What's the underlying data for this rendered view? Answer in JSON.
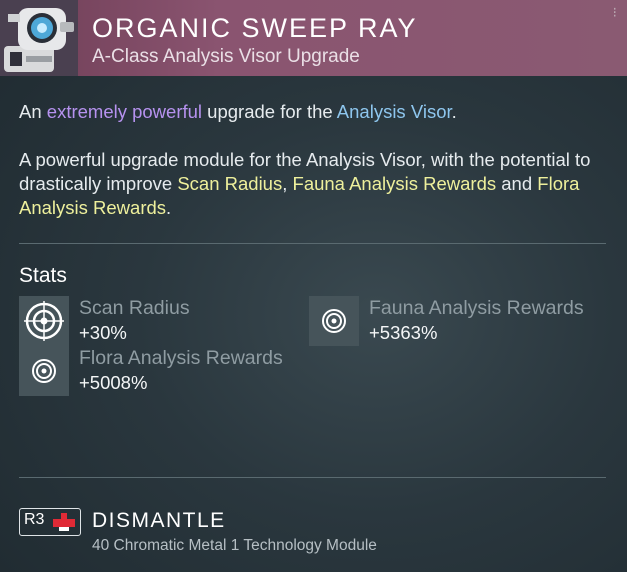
{
  "header": {
    "title": "ORGANIC SWEEP RAY",
    "subtitle": "A-Class Analysis Visor Upgrade",
    "icon": "robot-scanner-icon",
    "close": "⁝",
    "colors": {
      "accent_start": "#6e3d55",
      "accent_end": "#8a5a72"
    }
  },
  "description": {
    "line1_prefix": "An ",
    "line1_highlight": "extremely powerful",
    "line1_middle": " upgrade for the ",
    "line1_link": "Analysis Visor",
    "line1_suffix": ".",
    "para_prefix": "A powerful upgrade module for the Analysis Visor, with the potential to drastically improve ",
    "para_hl1": "Scan Radius",
    "para_sep1": ", ",
    "para_hl2": "Fauna Analysis Rewards",
    "para_sep2": " and ",
    "para_hl3": "Flora Analysis Rewards",
    "para_suffix": ".",
    "colors": {
      "purple": "#b692ef",
      "blue": "#8ec6ee",
      "yellow": "#eef09c"
    }
  },
  "stats": {
    "heading": "Stats",
    "items": [
      {
        "name": "Scan Radius",
        "value": "+30%",
        "icon": "target-icon"
      },
      {
        "name": "Fauna Analysis Rewards",
        "value": "+5363%",
        "icon": "target-icon"
      },
      {
        "name": "Flora Analysis Rewards",
        "value": "+5008%",
        "icon": "target-icon"
      }
    ]
  },
  "action": {
    "button_label": "R3",
    "label": "DISMANTLE",
    "rewards": "40 Chromatic Metal 1 Technology Module",
    "icon": "dismantle-icon"
  }
}
